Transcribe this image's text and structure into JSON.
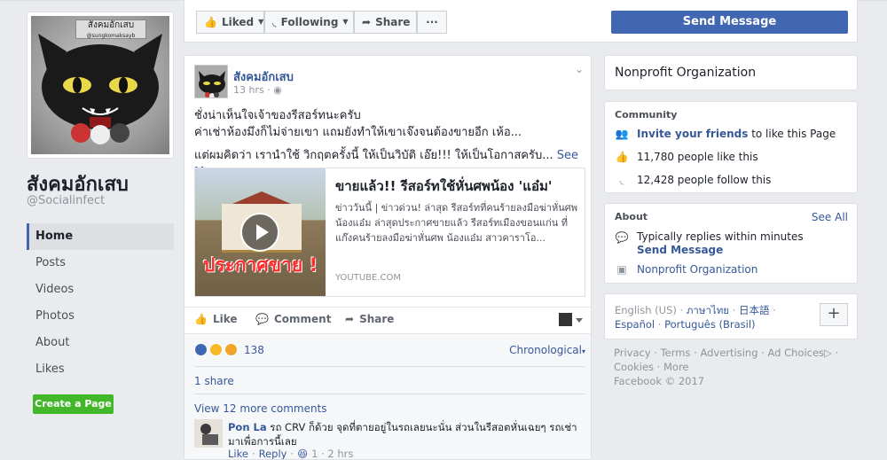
{
  "page": {
    "name": "สังคมอักเสบ",
    "handle": "@Socialinfect",
    "pic_caption": "สังคมอักเสบ",
    "pic_sub": "@sungkomaksayb"
  },
  "left_nav": [
    "Home",
    "Posts",
    "Videos",
    "Photos",
    "About",
    "Likes"
  ],
  "create_page": "Create a Page",
  "actions": {
    "liked": "Liked",
    "following": "Following",
    "share": "Share",
    "more": "···",
    "send_message": "Send Message"
  },
  "post": {
    "author": "สังคมอักเสบ",
    "time": "13 hrs · ",
    "line1": "ชั่งน่าเห็นใจเจ้าของรีสอร์ทนะครับ",
    "line2": "ค่าเช่าห้องมึงก็ไม่จ่ายเขา แถมยังทำให้เขาเจ๊งจนต้องขายอีก เห้อ...",
    "line3": "แต่ผมคิดว่า เรานำใช้ วิกฤตครั้งนี้ ให้เป็นวิบัติ เอ๊ย!!! ให้เป็นโอกาสครับ...",
    "see_more": "See More",
    "link": {
      "banner": "ประกาศขาย !",
      "title": "ขายแล้ว!! รีสอร์ทใช้หั่นศพน้อง 'แอ๋ม'",
      "desc": "ข่าววันนี้ | ข่าวด่วน! ล่าสุด รีสอร์ทที่คนร้ายลงมือฆ่าหั่นศพ น้องแอ๋ม ล่าสุดประกาศขายแล้ว รีสอร์ทเมืองขอนแก่น ที่แก๊งคนร้ายลงมือฆ่าหั่นศพ น้องแอ๋ม สาวคาราโอ...",
      "source": "YOUTUBE.COM"
    },
    "like": "Like",
    "comment": "Comment",
    "share": "Share",
    "reaction_count": "138",
    "sort": "Chronological",
    "share_count": "1 share",
    "view_more": "View 12 more comments",
    "comment1": {
      "name": "Pon La",
      "text": "รถ CRV ก็ด้วย จุดที่ตายอยู่ในรถเลยนะนั่น ส่วนในรีสอตหั่นเฉยๆ รถเช่ามาเพื่อการนี้เลย",
      "like": "Like",
      "reply": "Reply",
      "meta": "1 · 2 hrs"
    }
  },
  "right": {
    "category": "Nonprofit Organization",
    "community_head": "Community",
    "invite_link": "Invite your friends",
    "invite_rest": " to like this Page",
    "likes": "11,780 people like this",
    "follows": "12,428 people follow this",
    "about_head": "About",
    "see_all": "See All",
    "replies": "Typically replies within minutes",
    "send_message": "Send Message",
    "about_category": "Nonprofit Organization",
    "languages": {
      "l1": "English (US)",
      "l2": "ภาษาไทย",
      "l3": "日本語",
      "l4": "Español",
      "l5": "Português (Brasil)"
    },
    "plus": "+"
  },
  "footer": {
    "privacy": "Privacy",
    "terms": "Terms",
    "advertising": "Advertising",
    "adchoices": "Ad Choices",
    "cookies": "Cookies",
    "more": "More",
    "copyright": "Facebook © 2017"
  },
  "colors": {
    "fb_blue": "#4267b2",
    "link": "#365899",
    "green": "#42b72a"
  }
}
